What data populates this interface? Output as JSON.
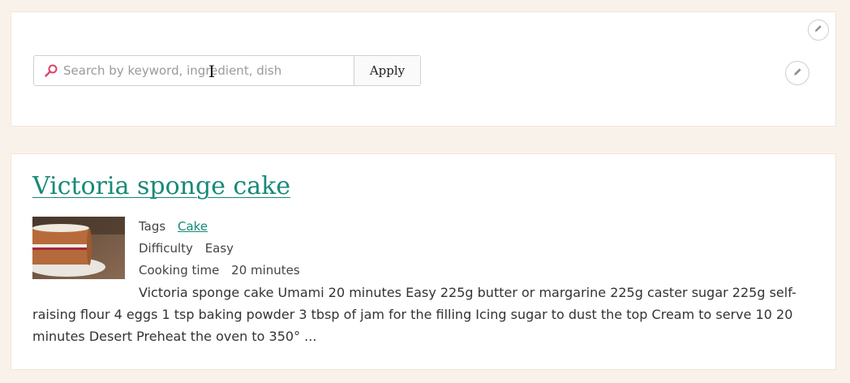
{
  "search": {
    "placeholder": "Search by keyword, ingredient, dish",
    "apply_label": "Apply"
  },
  "icons": {
    "search": "search-icon",
    "edit": "pencil-icon",
    "cursor": "text-cursor-icon"
  },
  "colors": {
    "page_background": "#f9f2ea",
    "link": "#178a78",
    "search_icon": "#d9436a"
  },
  "result": {
    "title": "Victoria sponge cake",
    "tags_label": "Tags",
    "tags": [
      "Cake"
    ],
    "difficulty_label": "Difficulty",
    "difficulty": "Easy",
    "cooking_time_label": "Cooking time",
    "cooking_time": "20 minutes",
    "summary": "Victoria sponge cake Umami 20 minutes Easy 225g butter or margarine 225g caster sugar 225g self-raising flour 4 eggs 1 tsp baking powder 3 tbsp of jam for the filling Icing sugar to dust the top Cream to serve 10 20 minutes Desert Preheat the oven to 350° ..."
  }
}
